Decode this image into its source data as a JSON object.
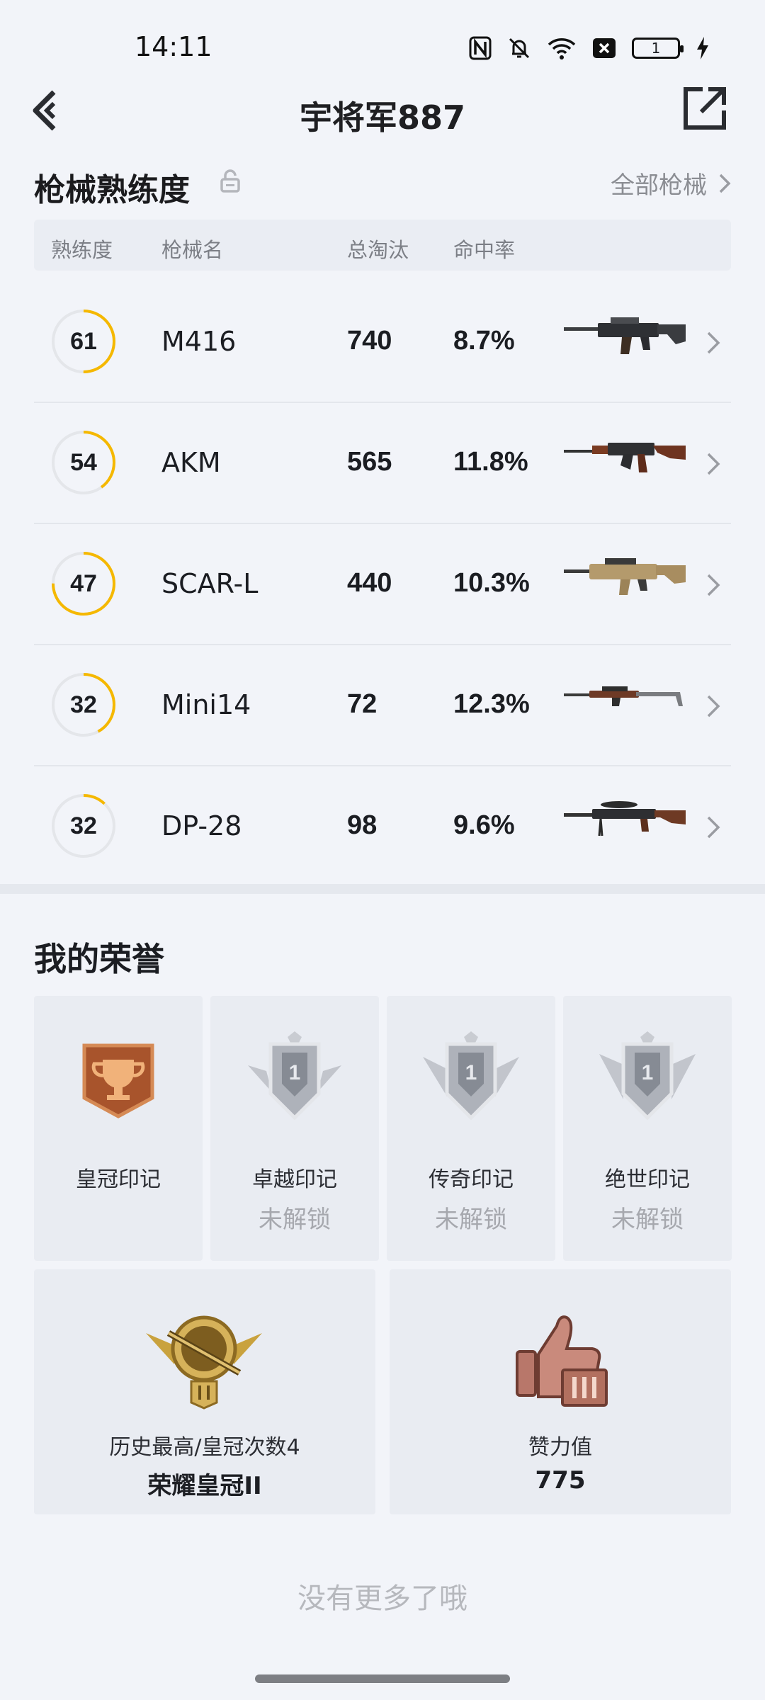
{
  "status_bar": {
    "time": "14:11",
    "battery_level": "1",
    "icons": [
      "nfc-icon",
      "mute-icon",
      "wifi-icon",
      "no-sim-icon",
      "battery-icon",
      "charging-icon"
    ]
  },
  "header": {
    "title": "宇将军887",
    "back_icon": "back-arrow-icon",
    "share_icon": "share-external-icon"
  },
  "weapon_section": {
    "title": "枪械熟练度",
    "all_label": "全部枪械",
    "columns": [
      "熟练度",
      "枪械名",
      "总淘汰",
      "命中率"
    ],
    "weapons": [
      {
        "level": "61",
        "name": "M416",
        "kills": "740",
        "rate": "8.7%",
        "progress": 0.5
      },
      {
        "level": "54",
        "name": "AKM",
        "kills": "565",
        "rate": "11.8%",
        "progress": 0.4
      },
      {
        "level": "47",
        "name": "SCAR-L",
        "kills": "440",
        "rate": "10.3%",
        "progress": 0.75
      },
      {
        "level": "32",
        "name": "Mini14",
        "kills": "72",
        "rate": "12.3%",
        "progress": 0.42
      },
      {
        "level": "32",
        "name": "DP-28",
        "kills": "98",
        "rate": "9.6%",
        "progress": 0.12
      }
    ]
  },
  "honor_section": {
    "title": "我的荣誉",
    "badges": [
      {
        "name": "皇冠印记",
        "status": ""
      },
      {
        "name": "卓越印记",
        "status": "未解锁"
      },
      {
        "name": "传奇印记",
        "status": "未解锁"
      },
      {
        "name": "绝世印记",
        "status": "未解锁"
      }
    ],
    "stats": [
      {
        "label": "历史最高/皇冠次数4",
        "value": "荣耀皇冠II"
      },
      {
        "label": "赞力值",
        "value": "775"
      }
    ]
  },
  "footer": {
    "no_more": "没有更多了哦"
  },
  "colors": {
    "accent": "#f5b800",
    "background": "#f2f4f9"
  }
}
